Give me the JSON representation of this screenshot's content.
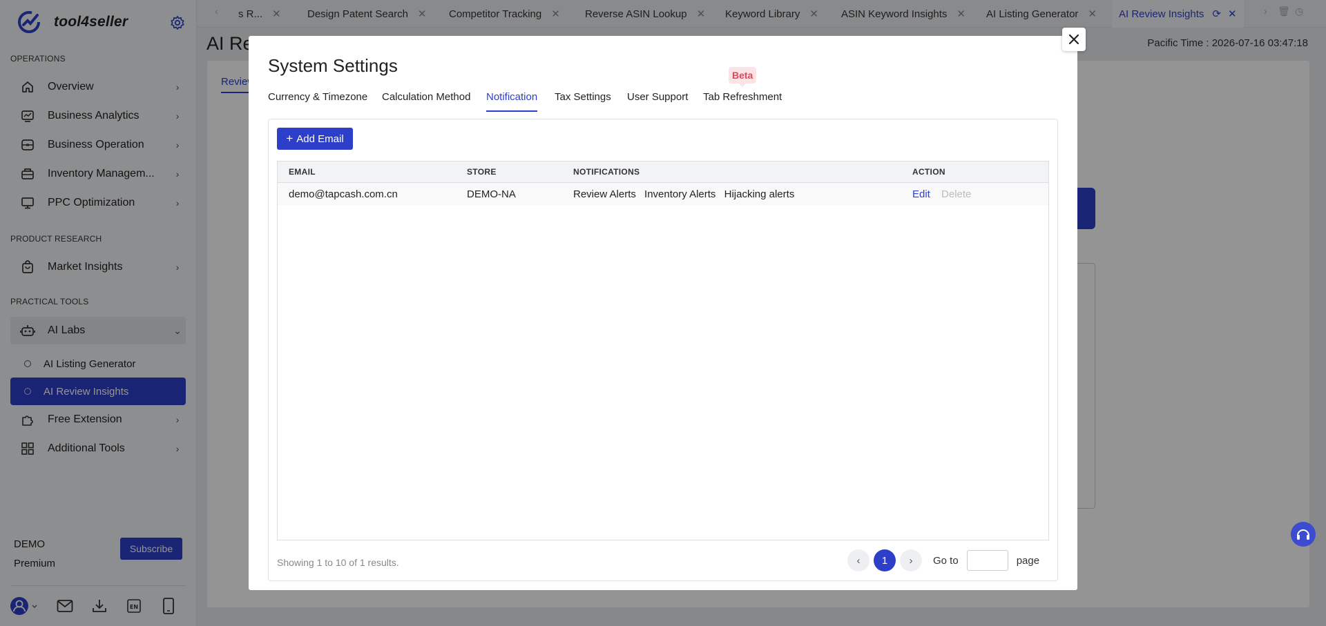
{
  "app": {
    "name": "tool4seller"
  },
  "sidebar": {
    "sections": [
      "OPERATIONS",
      "PRODUCT RESEARCH",
      "PRACTICAL TOOLS"
    ],
    "items": [
      {
        "label": "Overview",
        "icon": "home-icon"
      },
      {
        "label": "Business Analytics",
        "icon": "analytics-icon"
      },
      {
        "label": "Business Operation",
        "icon": "operation-icon"
      },
      {
        "label": "Inventory Managem...",
        "icon": "inventory-icon"
      },
      {
        "label": "PPC Optimization",
        "icon": "monitor-icon"
      },
      {
        "label": "Market Insights",
        "icon": "market-bag-icon"
      },
      {
        "label": "AI Labs",
        "icon": "robot-icon"
      },
      {
        "label": "Free Extension",
        "icon": "puzzle-icon"
      },
      {
        "label": "Additional Tools",
        "icon": "grid-icon"
      }
    ],
    "ai_labs_children": [
      "AI Listing Generator",
      "AI Review Insights"
    ],
    "account": {
      "name": "DEMO",
      "plan": "Premium",
      "subscribe_label": "Subscribe"
    }
  },
  "tabs": [
    {
      "label": "s R...",
      "active": false
    },
    {
      "label": "Design Patent Search",
      "active": false
    },
    {
      "label": "Competitor Tracking",
      "active": false
    },
    {
      "label": "Reverse ASIN Lookup",
      "active": false
    },
    {
      "label": "Keyword Library",
      "active": false
    },
    {
      "label": "ASIN Keyword Insights",
      "active": false
    },
    {
      "label": "AI Listing Generator",
      "active": false
    },
    {
      "label": "AI Review Insights",
      "active": true
    }
  ],
  "page": {
    "title": "AI Re",
    "tab": "Review",
    "pacific_label": "Pacific Time :",
    "pacific_time": "2026-07-16 03:47:18"
  },
  "modal": {
    "title": "System Settings",
    "tabs": [
      "Currency & Timezone",
      "Calculation Method",
      "Notification",
      "Tax Settings",
      "User Support",
      "Tab Refreshment"
    ],
    "active_tab": "Notification",
    "beta_label": "Beta",
    "add_email_label": "Add Email",
    "table": {
      "headers": [
        "EMAIL",
        "STORE",
        "NOTIFICATIONS",
        "ACTION"
      ],
      "rows": [
        {
          "email": "demo@tapcash.com.cn",
          "store": "DEMO-NA",
          "notifications": [
            "Review Alerts",
            "Inventory Alerts",
            "Hijacking alerts"
          ],
          "edit": "Edit",
          "delete": "Delete"
        }
      ]
    },
    "showing": "Showing 1 to 10 of 1 results.",
    "pagination": {
      "current": "1",
      "goto_label": "Go to",
      "page_label": "page",
      "goto_value": ""
    }
  },
  "colors": {
    "accent": "#2d3ec9",
    "beta_bg": "#fbe3e6",
    "beta_text": "#e04757"
  }
}
